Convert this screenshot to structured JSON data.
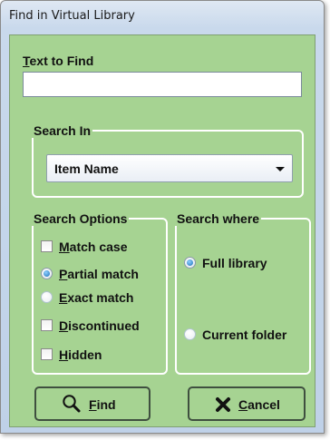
{
  "window": {
    "title": "Find in Virtual Library"
  },
  "text_to_find": {
    "label_mnemonic": "T",
    "label_rest": "ext to Find",
    "value": ""
  },
  "search_in": {
    "legend": "Search In",
    "selected": "Item Name"
  },
  "search_options": {
    "legend": "Search Options",
    "items": [
      {
        "type": "checkbox",
        "mnemonic": "M",
        "rest": "atch case",
        "checked": false
      },
      {
        "type": "radio",
        "mnemonic": "P",
        "rest": "artial match",
        "checked": true
      },
      {
        "type": "radio",
        "mnemonic": "E",
        "rest": "xact match",
        "checked": false
      },
      {
        "type": "checkbox",
        "mnemonic": "D",
        "rest": "iscontinued",
        "checked": false
      },
      {
        "type": "checkbox",
        "mnemonic": "H",
        "rest": "idden",
        "checked": false
      }
    ]
  },
  "search_where": {
    "legend": "Search where",
    "items": [
      {
        "label": "Full library",
        "checked": true
      },
      {
        "label": "Current folder",
        "checked": false
      }
    ]
  },
  "buttons": {
    "find_mnemonic": "F",
    "find_rest": "ind",
    "cancel_mnemonic": "C",
    "cancel_rest": "ancel"
  },
  "icons": {
    "find": "magnifier-icon",
    "cancel": "x-icon"
  },
  "colors": {
    "panel": "#a6d392",
    "group_border": "#ffffff",
    "radio_selected": "#1c6fb8"
  }
}
